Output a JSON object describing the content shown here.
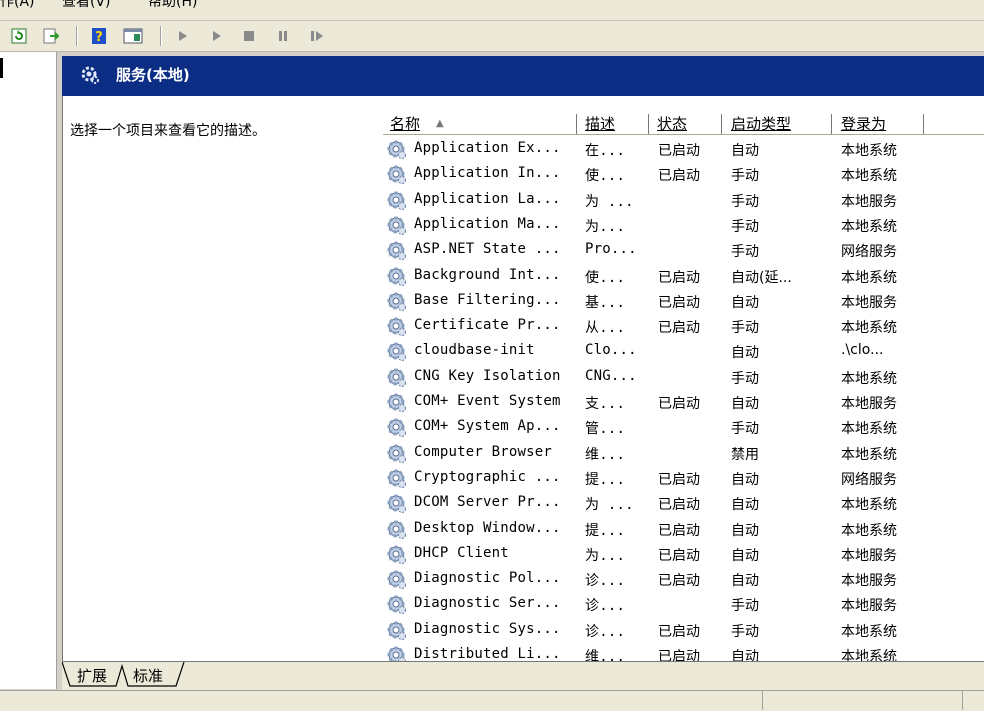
{
  "menu": [
    "操作(A)",
    "查看(V)",
    "帮助(H)"
  ],
  "header": {
    "title": "服务(本地)"
  },
  "description": {
    "prompt": "选择一个项目来查看它的描述。"
  },
  "columns": {
    "name": "名称",
    "desc": "描述",
    "status": "状态",
    "startup": "启动类型",
    "logon": "登录为"
  },
  "rows": [
    {
      "name": "Application Ex...",
      "desc": "在...",
      "status": "已启动",
      "startup": "自动",
      "logon": "本地系统"
    },
    {
      "name": "Application In...",
      "desc": "使...",
      "status": "已启动",
      "startup": "手动",
      "logon": "本地系统"
    },
    {
      "name": "Application La...",
      "desc": "为 ...",
      "status": "",
      "startup": "手动",
      "logon": "本地服务"
    },
    {
      "name": "Application Ma...",
      "desc": "为...",
      "status": "",
      "startup": "手动",
      "logon": "本地系统"
    },
    {
      "name": "ASP.NET State ...",
      "desc": "Pro...",
      "status": "",
      "startup": "手动",
      "logon": "网络服务"
    },
    {
      "name": "Background Int...",
      "desc": "使...",
      "status": "已启动",
      "startup": "自动(延...",
      "logon": "本地系统"
    },
    {
      "name": "Base Filtering...",
      "desc": "基...",
      "status": "已启动",
      "startup": "自动",
      "logon": "本地服务"
    },
    {
      "name": "Certificate Pr...",
      "desc": "从...",
      "status": "已启动",
      "startup": "手动",
      "logon": "本地系统"
    },
    {
      "name": "cloudbase-init",
      "desc": "Clo...",
      "status": "",
      "startup": "自动",
      "logon": ".\\clo..."
    },
    {
      "name": "CNG Key Isolation",
      "desc": "CNG...",
      "status": "",
      "startup": "手动",
      "logon": "本地系统"
    },
    {
      "name": "COM+ Event System",
      "desc": "支...",
      "status": "已启动",
      "startup": "自动",
      "logon": "本地服务"
    },
    {
      "name": "COM+ System Ap...",
      "desc": "管...",
      "status": "",
      "startup": "手动",
      "logon": "本地系统"
    },
    {
      "name": "Computer Browser",
      "desc": "维...",
      "status": "",
      "startup": "禁用",
      "logon": "本地系统"
    },
    {
      "name": "Cryptographic ...",
      "desc": "提...",
      "status": "已启动",
      "startup": "自动",
      "logon": "网络服务"
    },
    {
      "name": "DCOM Server Pr...",
      "desc": "为 ...",
      "status": "已启动",
      "startup": "自动",
      "logon": "本地系统"
    },
    {
      "name": "Desktop Window...",
      "desc": "提...",
      "status": "已启动",
      "startup": "自动",
      "logon": "本地系统"
    },
    {
      "name": "DHCP Client",
      "desc": "为...",
      "status": "已启动",
      "startup": "自动",
      "logon": "本地服务"
    },
    {
      "name": "Diagnostic Pol...",
      "desc": "诊...",
      "status": "已启动",
      "startup": "自动",
      "logon": "本地服务"
    },
    {
      "name": "Diagnostic Ser...",
      "desc": "诊...",
      "status": "",
      "startup": "手动",
      "logon": "本地服务"
    },
    {
      "name": "Diagnostic Sys...",
      "desc": "诊...",
      "status": "已启动",
      "startup": "手动",
      "logon": "本地系统"
    },
    {
      "name": "Distributed Li...",
      "desc": "维...",
      "status": "已启动",
      "startup": "自动",
      "logon": "本地系统"
    }
  ],
  "tabs": {
    "extended": "扩展",
    "standard": "标准"
  },
  "icons": {
    "refresh": "refresh-icon",
    "export": "export-list-icon",
    "help": "help-icon",
    "show_hide": "show-hide-pane-icon",
    "start": "start-service-icon",
    "start_alt": "start-service-alt-icon",
    "stop": "stop-service-icon",
    "pause": "pause-service-icon",
    "resume": "resume-service-icon",
    "service": "gear-icon"
  },
  "colors": {
    "header_bg": "#0b2d83",
    "chrome": "#ece9d8"
  }
}
